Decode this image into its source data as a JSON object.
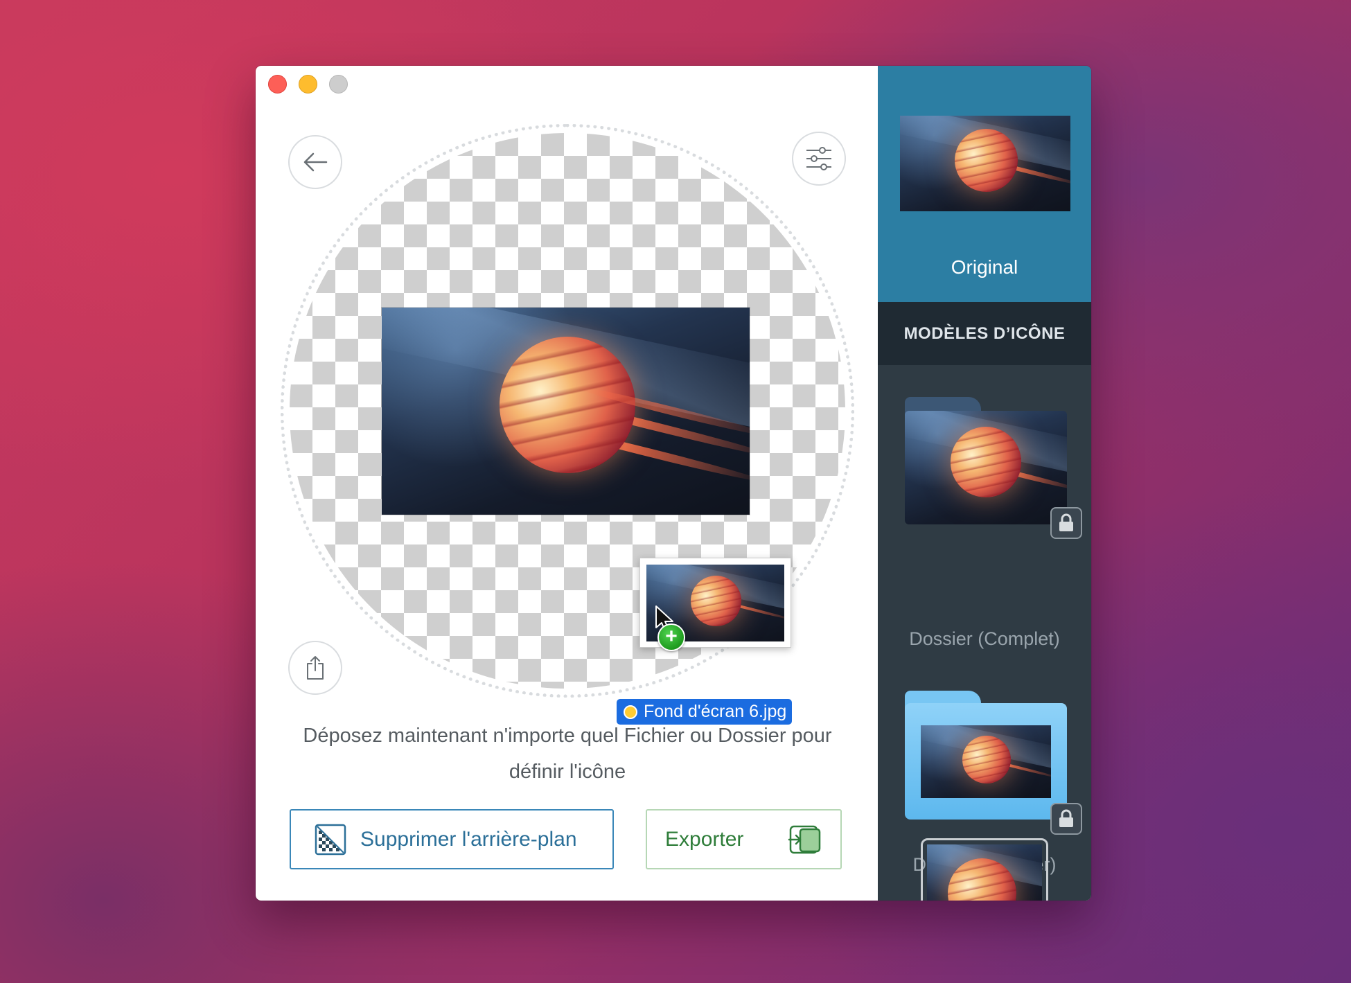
{
  "window": {
    "traffic_lights": [
      "close",
      "minimize",
      "zoom"
    ]
  },
  "main": {
    "back_icon": "arrow-left-icon",
    "settings_icon": "sliders-icon",
    "share_icon": "share-icon",
    "drag_file_name": "Fond d'écran 6.jpg",
    "hint_line1": "Déposez maintenant n'importe quel Fichier ou Dossier pour",
    "hint_line2": "définir l'icône",
    "remove_bg_label": "Supprimer l'arrière-plan",
    "export_label": "Exporter"
  },
  "sidebar": {
    "original_label": "Original",
    "section_title": "MODÈLES D’ICÔNE",
    "templates": [
      {
        "label": "Dossier (Complet)",
        "locked": true
      },
      {
        "label": "Dossier (Centrer)",
        "locked": true
      }
    ]
  },
  "colors": {
    "accent_blue": "#2c7ea3",
    "sidebar_bg": "#2f3b44",
    "section_bg": "#1f2a33",
    "export_green": "#2f7d3a",
    "remove_blue": "#2b6f98",
    "folder_blue": "#5db8ee"
  }
}
